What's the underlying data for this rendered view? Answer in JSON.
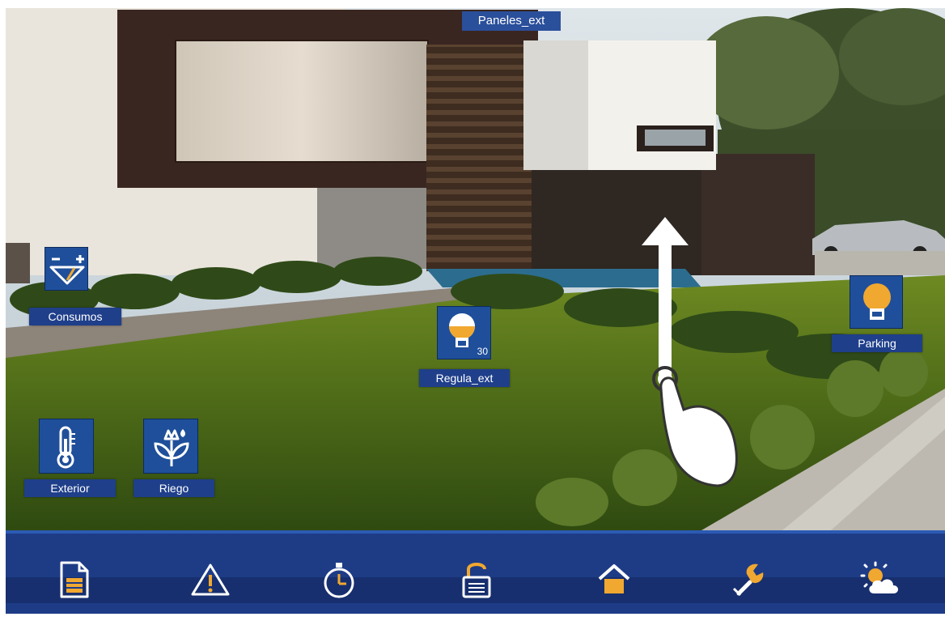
{
  "panel": {
    "title": "Paneles_ext"
  },
  "widgets": {
    "consumos": {
      "label": "Consumos",
      "icon": "gauge-icon"
    },
    "regula_ext": {
      "label": "Regula_ext",
      "value": "30",
      "icon": "dimmer-bulb-icon"
    },
    "parking": {
      "label": "Parking",
      "icon": "bulb-icon"
    },
    "exterior": {
      "label": "Exterior",
      "icon": "thermometer-icon"
    },
    "riego": {
      "label": "Riego",
      "icon": "irrigation-plant-icon"
    }
  },
  "navbar": [
    {
      "name": "document-icon"
    },
    {
      "name": "alarm-warning-icon"
    },
    {
      "name": "timer-clock-icon"
    },
    {
      "name": "unlock-icon"
    },
    {
      "name": "home-icon"
    },
    {
      "name": "settings-wrench-icon"
    },
    {
      "name": "weather-icon"
    }
  ],
  "colors": {
    "accent_orange": "#f0a830",
    "tile_blue": "#1f4f9a",
    "bar_blue": "#1e3c86"
  }
}
